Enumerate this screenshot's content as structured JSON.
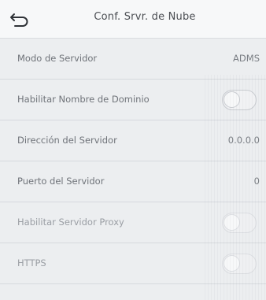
{
  "header": {
    "title": "Conf. Srvr. de Nube",
    "back_icon": "back-arrow-icon"
  },
  "rows": [
    {
      "label": "Modo de Servidor",
      "value": "ADMS",
      "kind": "value"
    },
    {
      "label": "Habilitar Nombre de Dominio",
      "kind": "toggle",
      "on": false
    },
    {
      "label": "Dirección del Servidor",
      "value": "0.0.0.0",
      "kind": "value"
    },
    {
      "label": "Puerto del Servidor",
      "value": "0",
      "kind": "value"
    },
    {
      "label": "Habilitar Servidor Proxy",
      "kind": "toggle",
      "on": false
    },
    {
      "label": "HTTPS",
      "kind": "toggle",
      "on": false
    }
  ],
  "colors": {
    "background": "#eceef0",
    "header": "#f7f8f9",
    "text": "#6f7379",
    "divider": "#d6d9de"
  }
}
